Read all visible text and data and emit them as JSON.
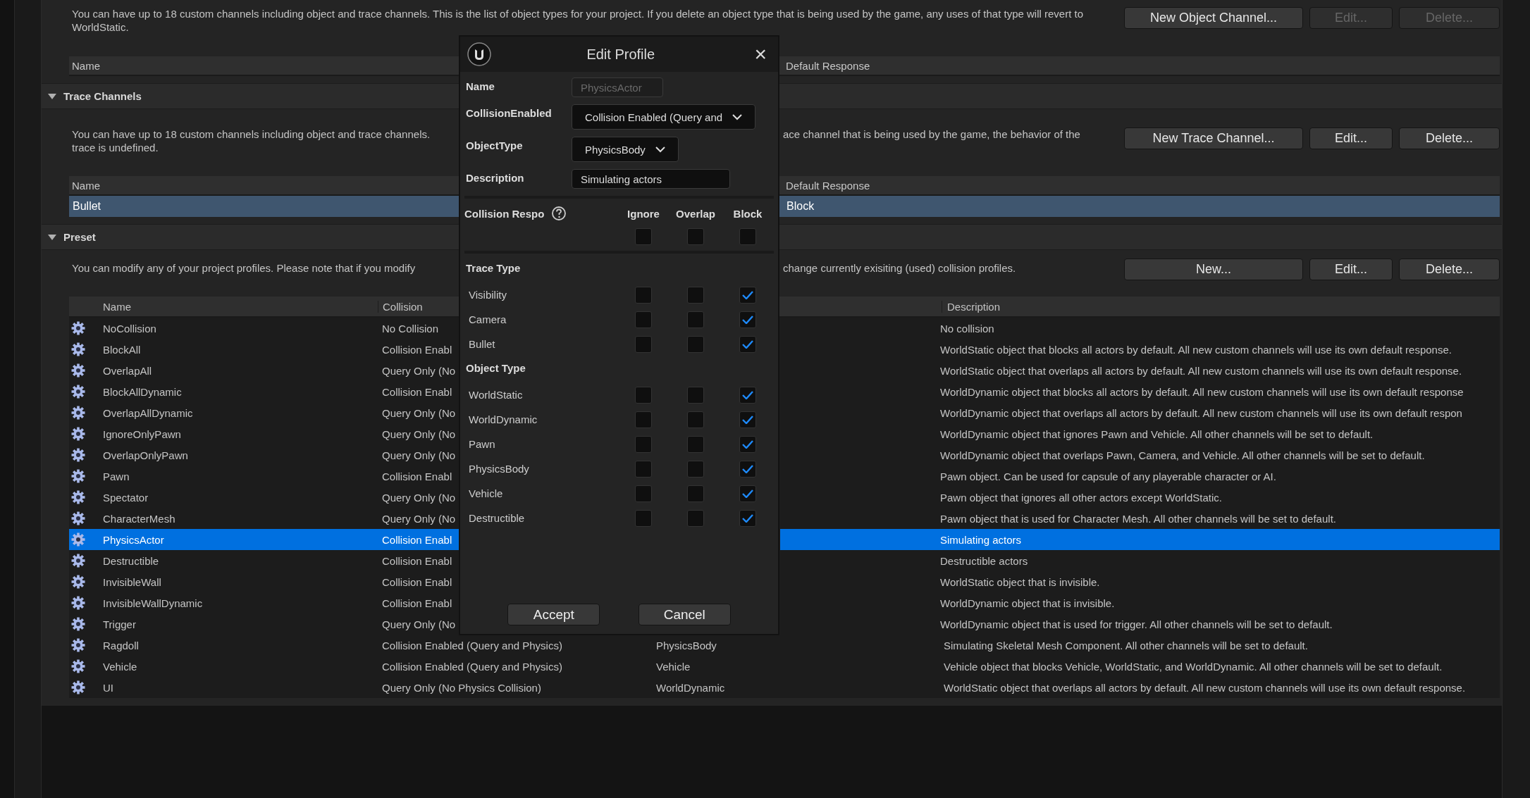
{
  "object_channels": {
    "description": "You can have up to 18 custom channels including object and trace channels. This is the list of object types for your project. If you delete an object type that is being used by the game, any uses of that type will revert to WorldStatic.",
    "buttons": [
      {
        "label": "New Object Channel...",
        "disabled": false
      },
      {
        "label": "Edit...",
        "disabled": true
      },
      {
        "label": "Delete...",
        "disabled": true
      }
    ],
    "columns": {
      "name": "Name",
      "default_response": "Default Response"
    }
  },
  "trace_channels": {
    "title": "Trace Channels",
    "expanded": true,
    "text_left": [
      "You can have up to 18 custom channels including object and trace channels.",
      "trace is undefined."
    ],
    "text_right": "ace channel that is being used by the game, the behavior of the",
    "buttons": [
      {
        "label": "New Trace Channel...",
        "disabled": false
      },
      {
        "label": "Edit...",
        "disabled": false
      },
      {
        "label": "Delete...",
        "disabled": false
      }
    ],
    "columns": {
      "name": "Name",
      "default_response": "Default Response"
    },
    "rows": [
      {
        "name": "Bullet",
        "default_response": "Block",
        "selected": true
      }
    ]
  },
  "preset": {
    "title": "Preset",
    "expanded": true,
    "text_left": "You can modify any of your project profiles. Please note that if you modify",
    "text_right": "change currently exisiting (used) collision profiles.",
    "buttons": [
      {
        "label": "New...",
        "disabled": false
      },
      {
        "label": "Edit...",
        "disabled": false
      },
      {
        "label": "Delete...",
        "disabled": false
      }
    ],
    "columns": {
      "name": "Name",
      "collision": "Collision",
      "description": "Description"
    },
    "rows": [
      {
        "name": "NoCollision",
        "collision": "No Collision",
        "description": "No collision",
        "selected": false
      },
      {
        "name": "BlockAll",
        "collision": "Collision Enabl",
        "description": "WorldStatic object that blocks all actors by default. All new custom channels will use its own default response.",
        "selected": false
      },
      {
        "name": "OverlapAll",
        "collision": "Query Only (No",
        "description": "WorldStatic object that overlaps all actors by default. All new custom channels will use its own default response.",
        "selected": false
      },
      {
        "name": "BlockAllDynamic",
        "collision": "Collision Enabl",
        "description": "WorldDynamic object that blocks all actors by default. All new custom channels will use its own default response",
        "selected": false
      },
      {
        "name": "OverlapAllDynamic",
        "collision": "Query Only (No",
        "description": "WorldDynamic object that overlaps all actors by default. All new custom channels will use its own default respon",
        "selected": false
      },
      {
        "name": "IgnoreOnlyPawn",
        "collision": "Query Only (No",
        "description": "WorldDynamic object that ignores Pawn and Vehicle. All other channels will be set to default.",
        "selected": false
      },
      {
        "name": "OverlapOnlyPawn",
        "collision": "Query Only (No",
        "description": "WorldDynamic object that overlaps Pawn, Camera, and Vehicle. All other channels will be set to default.",
        "selected": false
      },
      {
        "name": "Pawn",
        "collision": "Collision Enabl",
        "description": "Pawn object. Can be used for capsule of any playerable character or AI.",
        "selected": false
      },
      {
        "name": "Spectator",
        "collision": "Query Only (No",
        "description": "Pawn object that ignores all other actors except WorldStatic.",
        "selected": false
      },
      {
        "name": "CharacterMesh",
        "collision": "Query Only (No",
        "description": "Pawn object that is used for Character Mesh. All other channels will be set to default.",
        "selected": false
      },
      {
        "name": "PhysicsActor",
        "collision": "Collision Enabl",
        "description": "Simulating actors",
        "selected": true
      },
      {
        "name": "Destructible",
        "collision": "Collision Enabl",
        "description": "Destructible actors",
        "selected": false
      },
      {
        "name": "InvisibleWall",
        "collision": "Collision Enabl",
        "description": "WorldStatic object that is invisible.",
        "selected": false
      },
      {
        "name": "InvisibleWallDynamic",
        "collision": "Collision Enabl",
        "description": "WorldDynamic object that is invisible.",
        "selected": false
      },
      {
        "name": "Trigger",
        "collision": "Query Only (No",
        "description": "WorldDynamic object that is used for trigger. All other channels will be set to default.",
        "selected": false
      },
      {
        "name": "Ragdoll",
        "collision": "Collision Enabled (Query and Physics)",
        "object_type": "PhysicsBody",
        "description": "Simulating Skeletal Mesh Component. All other channels will be set to default.",
        "selected": false
      },
      {
        "name": "Vehicle",
        "collision": "Collision Enabled (Query and Physics)",
        "object_type": "Vehicle",
        "description": "Vehicle object that blocks Vehicle, WorldStatic, and WorldDynamic. All other channels will be set to default.",
        "selected": false
      },
      {
        "name": "UI",
        "collision": "Query Only (No Physics Collision)",
        "object_type": "WorldDynamic",
        "description": "WorldStatic object that overlaps all actors by default. All new custom channels will use its own default response.",
        "selected": false
      }
    ]
  },
  "dialog": {
    "title": "Edit Profile",
    "close": "×",
    "fields": [
      {
        "kind": "text",
        "label": "Name",
        "value": "PhysicsActor",
        "disabled": true
      },
      {
        "kind": "combo",
        "label": "CollisionEnabled",
        "value": "Collision Enabled (Query and",
        "disabled": false
      },
      {
        "kind": "combo",
        "label": "ObjectType",
        "value": "PhysicsBody",
        "disabled": false
      },
      {
        "kind": "text",
        "label": "Description",
        "value": "Simulating actors",
        "disabled": false
      }
    ],
    "responses": {
      "label": "Collision Respo",
      "columns": [
        "Ignore",
        "Overlap",
        "Block"
      ],
      "ignore": false,
      "overlap": false,
      "block": false
    },
    "groups": [
      {
        "title": "Trace Type",
        "rows": [
          {
            "label": "Visibility",
            "ignore": false,
            "overlap": false,
            "block": true
          },
          {
            "label": "Camera",
            "ignore": false,
            "overlap": false,
            "block": true
          },
          {
            "label": "Bullet",
            "ignore": false,
            "overlap": false,
            "block": true
          }
        ]
      },
      {
        "title": "Object Type",
        "rows": [
          {
            "label": "WorldStatic",
            "ignore": false,
            "overlap": false,
            "block": true
          },
          {
            "label": "WorldDynamic",
            "ignore": false,
            "overlap": false,
            "block": true
          },
          {
            "label": "Pawn",
            "ignore": false,
            "overlap": false,
            "block": true
          },
          {
            "label": "PhysicsBody",
            "ignore": false,
            "overlap": false,
            "block": true
          },
          {
            "label": "Vehicle",
            "ignore": false,
            "overlap": false,
            "block": true
          },
          {
            "label": "Destructible",
            "ignore": false,
            "overlap": false,
            "block": true
          }
        ]
      }
    ],
    "buttons": [
      "Accept",
      "Cancel"
    ]
  }
}
